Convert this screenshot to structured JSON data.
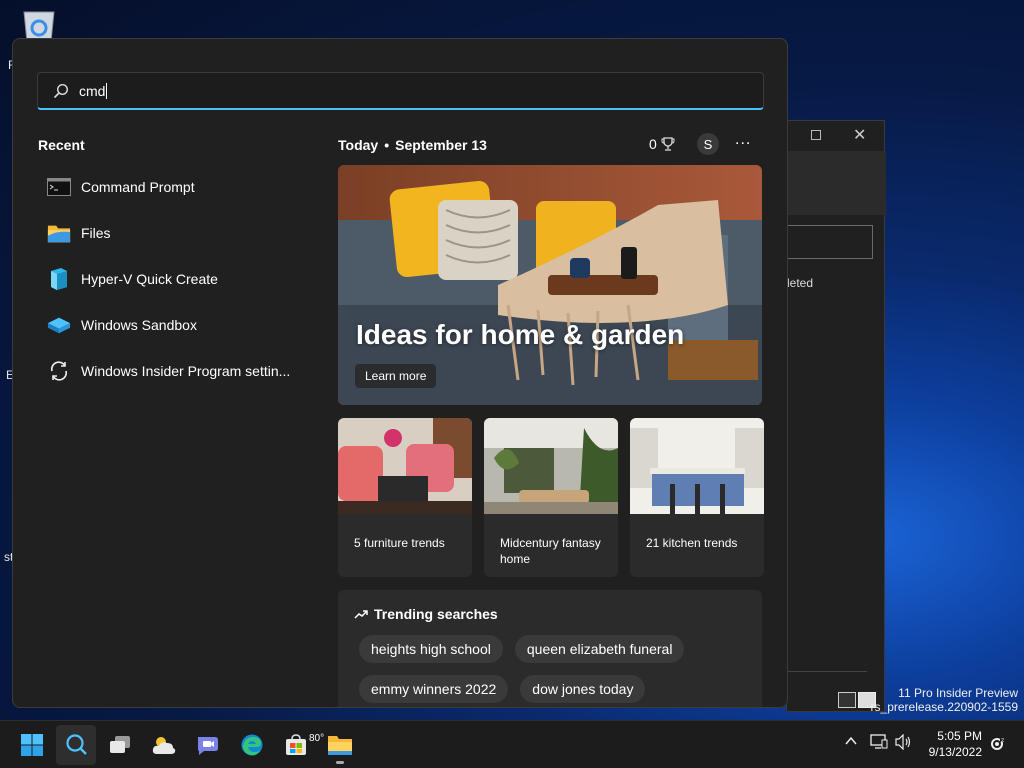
{
  "search": {
    "value": "cmd"
  },
  "recent": {
    "title": "Recent",
    "items": [
      {
        "label": "Command Prompt",
        "icon": "command-prompt-icon"
      },
      {
        "label": "Files",
        "icon": "folder-icon"
      },
      {
        "label": "Hyper-V Quick Create",
        "icon": "hyperv-icon"
      },
      {
        "label": "Windows Sandbox",
        "icon": "sandbox-icon"
      },
      {
        "label": "Windows Insider Program settin...",
        "icon": "sync-icon"
      }
    ]
  },
  "today": {
    "label": "Today",
    "date": "September 13",
    "points": "0",
    "avatar": "S",
    "more": "..."
  },
  "hero": {
    "title": "Ideas for home & garden",
    "button": "Learn more"
  },
  "cards": [
    {
      "caption": "5 furniture trends"
    },
    {
      "caption": "Midcentury fantasy home"
    },
    {
      "caption": "21 kitchen trends"
    }
  ],
  "trending": {
    "title": "Trending searches",
    "items": [
      "heights high school",
      "queen elizabeth funeral",
      "emmy winners 2022",
      "dow jones today"
    ]
  },
  "taskbar": {
    "weather_temp": "80°",
    "time": "5:05 PM",
    "date": "9/13/2022"
  },
  "desktop": {
    "watermark_line1": "11 Pro Insider Preview",
    "watermark_line2": "rs_prerelease.220902-1559",
    "bg_window_text": "leted",
    "frag_r": "R",
    "frag_e": "E",
    "frag_st": "st"
  },
  "colors": {
    "accent": "#4cc2ff",
    "panel": "#202020",
    "card": "#2b2b2b",
    "taskbar": "#1c1c1c"
  }
}
